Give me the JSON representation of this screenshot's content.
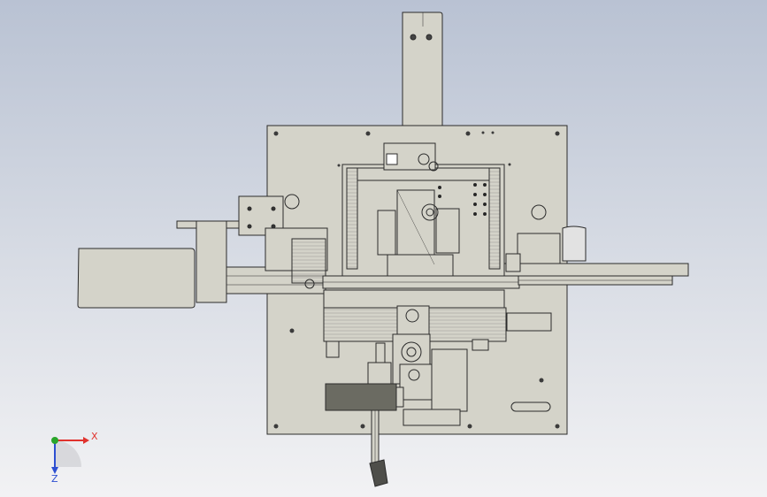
{
  "viewport": {
    "background_top": "#b9c2d3",
    "background_bottom": "#f2f2f4"
  },
  "model": {
    "plate_color": "#d4d3c9",
    "line_color": "#2b2b2b",
    "dark_block_color": "#6b6b62",
    "tube_color": "#cfcfcf"
  },
  "triad": {
    "x_label": "X",
    "z_label": "Z",
    "x_color": "#e0332e",
    "y_color": "#2aa52a",
    "z_color": "#2d4fd1"
  }
}
